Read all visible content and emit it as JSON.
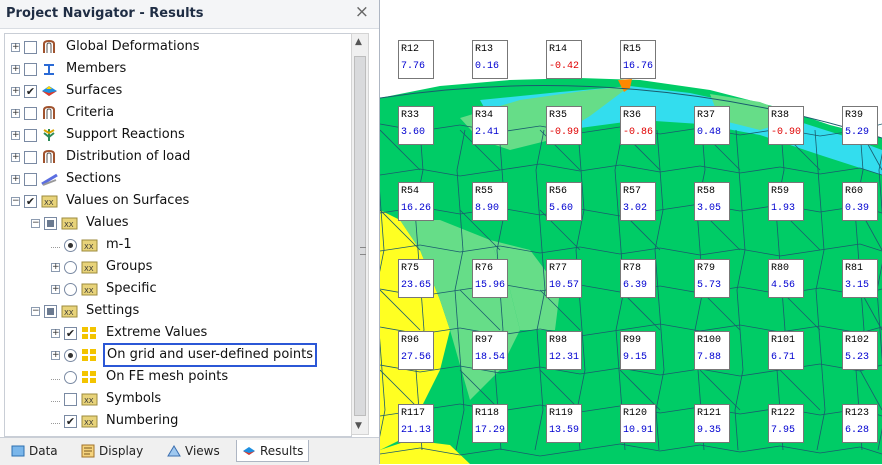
{
  "navigator": {
    "title": "Project Navigator - Results",
    "close_glyph": "×",
    "items": [
      {
        "label": "Global Deformations",
        "icon": "deformation-icon",
        "checked": "off"
      },
      {
        "label": "Members",
        "icon": "member-icon",
        "checked": "off"
      },
      {
        "label": "Surfaces",
        "icon": "surface-icon",
        "checked": "on"
      },
      {
        "label": "Criteria",
        "icon": "deformation-icon",
        "checked": "off"
      },
      {
        "label": "Support Reactions",
        "icon": "support-icon",
        "checked": "off"
      },
      {
        "label": "Distribution of load",
        "icon": "deformation-icon",
        "checked": "off"
      },
      {
        "label": "Sections",
        "icon": "section-icon",
        "checked": "off"
      },
      {
        "label": "Values on Surfaces",
        "icon": "xx-icon",
        "checked": "on"
      },
      {
        "label": "Values",
        "icon": "xx-icon",
        "checked": "partial"
      },
      {
        "label": "m-1",
        "icon": "xx-icon",
        "radio": "on"
      },
      {
        "label": "Groups",
        "icon": "xx-icon",
        "radio": "off"
      },
      {
        "label": "Specific",
        "icon": "xx-icon",
        "radio": "off"
      },
      {
        "label": "Settings",
        "icon": "xx-icon",
        "checked": "partial"
      },
      {
        "label": "Extreme Values",
        "icon": "grid-icon",
        "checked": "on"
      },
      {
        "label": "On grid and user-defined points",
        "icon": "grid-icon",
        "radio": "on"
      },
      {
        "label": "On FE mesh points",
        "icon": "grid-icon",
        "radio": "off"
      },
      {
        "label": "Symbols",
        "icon": "xx-icon",
        "checked": "off"
      },
      {
        "label": "Numbering",
        "icon": "xx-icon",
        "checked": "on"
      }
    ],
    "tabs": [
      {
        "label": "Data",
        "icon": "data-icon"
      },
      {
        "label": "Display",
        "icon": "display-icon"
      },
      {
        "label": "Views",
        "icon": "views-icon"
      },
      {
        "label": "Results",
        "icon": "results-icon"
      }
    ]
  },
  "colors": {
    "green": "#00cc66",
    "light_green": "#66dd88",
    "cyan": "#33ddee",
    "yellow": "#ffff22",
    "orange": "#ff8800",
    "mesh": "#1a5c6e",
    "value_blue": "#0000d0",
    "value_red": "#e00000",
    "selection": "#2b57d6"
  },
  "results": {
    "rows": [
      [
        {
          "id": "R12",
          "value": "7.76"
        },
        {
          "id": "R13",
          "value": "0.16"
        },
        {
          "id": "R14",
          "value": "-0.42"
        },
        {
          "id": "R15",
          "value": "16.76"
        }
      ],
      [
        {
          "id": "R33",
          "value": "3.60"
        },
        {
          "id": "R34",
          "value": "2.41"
        },
        {
          "id": "R35",
          "value": "-0.99"
        },
        {
          "id": "R36",
          "value": "-0.86"
        },
        {
          "id": "R37",
          "value": "0.48"
        },
        {
          "id": "R38",
          "value": "-0.90"
        },
        {
          "id": "R39",
          "value": "5.29"
        }
      ],
      [
        {
          "id": "R54",
          "value": "16.26"
        },
        {
          "id": "R55",
          "value": "8.90"
        },
        {
          "id": "R56",
          "value": "5.60"
        },
        {
          "id": "R57",
          "value": "3.02"
        },
        {
          "id": "R58",
          "value": "3.05"
        },
        {
          "id": "R59",
          "value": "1.93"
        },
        {
          "id": "R60",
          "value": "0.39"
        }
      ],
      [
        {
          "id": "R75",
          "value": "23.65"
        },
        {
          "id": "R76",
          "value": "15.96"
        },
        {
          "id": "R77",
          "value": "10.57"
        },
        {
          "id": "R78",
          "value": "6.39"
        },
        {
          "id": "R79",
          "value": "5.73"
        },
        {
          "id": "R80",
          "value": "4.56"
        },
        {
          "id": "R81",
          "value": "3.15"
        }
      ],
      [
        {
          "id": "R96",
          "value": "27.56"
        },
        {
          "id": "R97",
          "value": "18.54"
        },
        {
          "id": "R98",
          "value": "12.31"
        },
        {
          "id": "R99",
          "value": "9.15"
        },
        {
          "id": "R100",
          "value": "7.88"
        },
        {
          "id": "R101",
          "value": "6.71"
        },
        {
          "id": "R102",
          "value": "5.23"
        }
      ],
      [
        {
          "id": "R117",
          "value": "21.13"
        },
        {
          "id": "R118",
          "value": "17.29"
        },
        {
          "id": "R119",
          "value": "13.59"
        },
        {
          "id": "R120",
          "value": "10.91"
        },
        {
          "id": "R121",
          "value": "9.35"
        },
        {
          "id": "R122",
          "value": "7.95"
        },
        {
          "id": "R123",
          "value": "6.28"
        }
      ]
    ]
  }
}
